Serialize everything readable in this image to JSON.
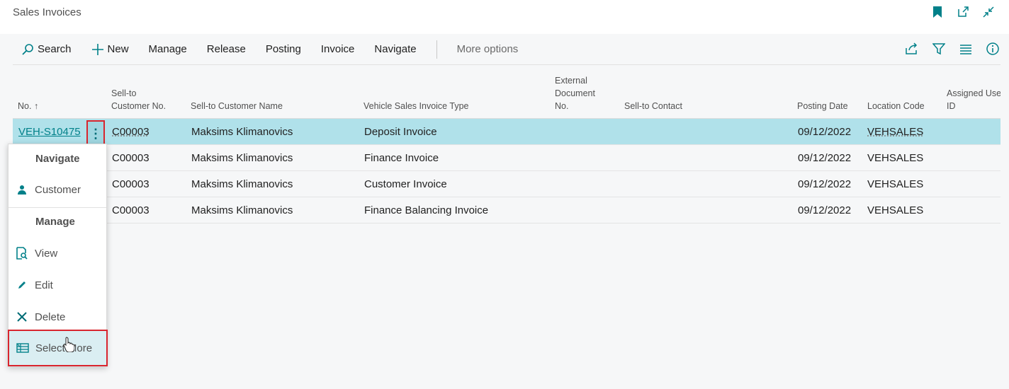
{
  "page": {
    "title": "Sales Invoices"
  },
  "title_icons": [
    "bookmark-icon",
    "open-in-new-window-icon",
    "collapse-icon"
  ],
  "actions": {
    "search": "Search",
    "new": "New",
    "manage": "Manage",
    "release": "Release",
    "posting": "Posting",
    "invoice": "Invoice",
    "navigate": "Navigate",
    "more_options": "More options"
  },
  "right_actions": [
    "share-icon",
    "filter-icon",
    "list-view-icon",
    "info-icon"
  ],
  "columns": {
    "no": "No.",
    "sort_indicator": "↑",
    "sell_to_no_1": "Sell-to",
    "sell_to_no_2": "Customer No.",
    "sell_to_name": "Sell-to Customer Name",
    "invoice_type": "Vehicle Sales Invoice Type",
    "ext_doc_1": "External",
    "ext_doc_2": "Document",
    "ext_doc_3": "No.",
    "sell_to_contact": "Sell-to Contact",
    "posting_date": "Posting Date",
    "location_code": "Location Code",
    "assigned_user_1": "Assigned Use",
    "assigned_user_2": "ID"
  },
  "rows": [
    {
      "no": "VEH-S10475",
      "customer_no": "C00003",
      "customer_name": "Maksims Klimanovics",
      "type": "Deposit Invoice",
      "posting_date": "09/12/2022",
      "location": "VEHSALES"
    },
    {
      "no": "",
      "customer_no": "C00003",
      "customer_name": "Maksims Klimanovics",
      "type": "Finance Invoice",
      "posting_date": "09/12/2022",
      "location": "VEHSALES"
    },
    {
      "no": "",
      "customer_no": "C00003",
      "customer_name": "Maksims Klimanovics",
      "type": "Customer Invoice",
      "posting_date": "09/12/2022",
      "location": "VEHSALES"
    },
    {
      "no": "",
      "customer_no": "C00003",
      "customer_name": "Maksims Klimanovics",
      "type": "Finance Balancing Invoice",
      "posting_date": "09/12/2022",
      "location": "VEHSALES"
    }
  ],
  "row_menu": {
    "glyph": "⋮"
  },
  "context_menu": {
    "navigate_heading": "Navigate",
    "customer": "Customer",
    "manage_heading": "Manage",
    "view": "View",
    "edit": "Edit",
    "delete": "Delete",
    "select_more": "Select More"
  },
  "colors": {
    "accent": "#008089",
    "selected_row": "#b0e1ea",
    "highlight_box": "#d9252e"
  }
}
